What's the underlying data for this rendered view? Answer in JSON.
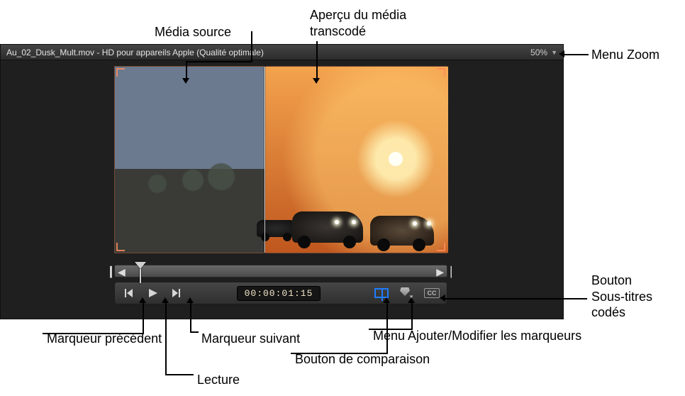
{
  "callouts": {
    "media_source": "Média source",
    "transcoded_preview_l1": "Aperçu du média",
    "transcoded_preview_l2": "transcodé",
    "zoom_menu": "Menu Zoom",
    "prev_marker": "Marqueur précédent",
    "playback": "Lecture",
    "next_marker": "Marqueur suivant",
    "compare_button": "Bouton de comparaison",
    "marker_menu": "Menu Ajouter/Modifier les marqueurs",
    "cc_l1": "Bouton",
    "cc_l2": "Sous-titres",
    "cc_l3": "codés"
  },
  "titlebar": {
    "text": "Au_02_Dusk_Mult.mov - HD pour appareils Apple (Qualité optimale)"
  },
  "zoom": {
    "value": "50%"
  },
  "transport": {
    "timecode": "00:00:01:15",
    "cc_label": "CC"
  },
  "icons": {
    "prev": "previous-marker-icon",
    "play": "play-icon",
    "next": "next-marker-icon",
    "compare": "compare-icon",
    "marker": "marker-menu-icon",
    "cc": "closed-caption-icon",
    "zoom_dropdown": "chevron-down-icon"
  }
}
